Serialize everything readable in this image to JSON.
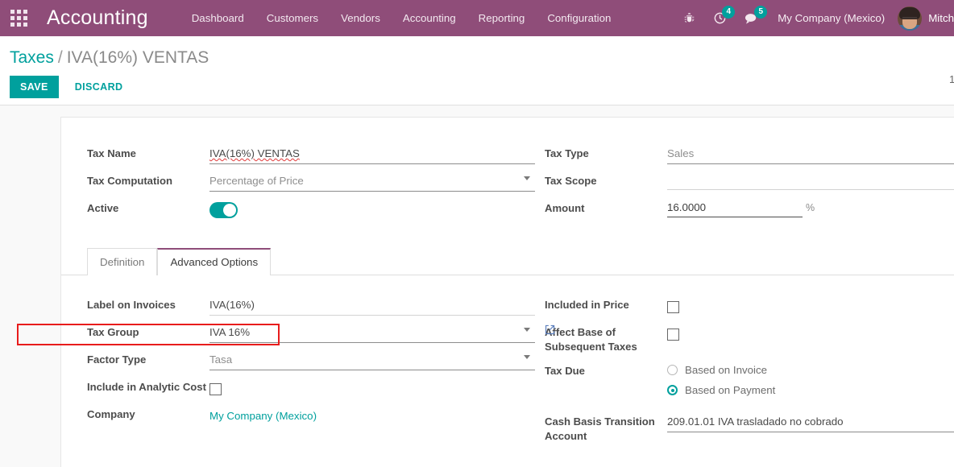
{
  "navbar": {
    "apps_icon": "apps-grid-icon",
    "brand": "Accounting",
    "menu": [
      {
        "label": "Dashboard"
      },
      {
        "label": "Customers"
      },
      {
        "label": "Vendors"
      },
      {
        "label": "Accounting"
      },
      {
        "label": "Reporting"
      },
      {
        "label": "Configuration"
      }
    ],
    "icons": [
      {
        "name": "bug-icon",
        "badge": null
      },
      {
        "name": "activity-clock-icon",
        "badge": "4"
      },
      {
        "name": "messages-icon",
        "badge": "5"
      }
    ],
    "company": "My Company (Mexico)",
    "user": "Mitch",
    "bg_color": "#8f4d79"
  },
  "control_panel": {
    "breadcrumb_root": "Taxes",
    "breadcrumb_sep": "/",
    "breadcrumb_current": "IVA(16%) VENTAS",
    "save_label": "SAVE",
    "discard_label": "DISCARD",
    "pager": "1",
    "accent_color": "#00a09d"
  },
  "form": {
    "left": {
      "tax_name_label": "Tax Name",
      "tax_name_value": "IVA(16%) VENTAS",
      "tax_computation_label": "Tax Computation",
      "tax_computation_value": "Percentage of Price",
      "active_label": "Active",
      "active_value": "on"
    },
    "right": {
      "tax_type_label": "Tax Type",
      "tax_type_value": "Sales",
      "tax_scope_label": "Tax Scope",
      "tax_scope_value": "",
      "amount_label": "Amount",
      "amount_value": "16.0000",
      "amount_suffix": "%"
    }
  },
  "notebook": {
    "tabs": [
      {
        "label": "Definition",
        "active": false
      },
      {
        "label": "Advanced Options",
        "active": true
      }
    ]
  },
  "advanced": {
    "left": {
      "label_on_invoices_label": "Label on Invoices",
      "label_on_invoices_value": "IVA(16%)",
      "tax_group_label": "Tax Group",
      "tax_group_value": "IVA 16%",
      "factor_type_label": "Factor Type",
      "factor_type_value": "Tasa",
      "include_analytic_label": "Include in Analytic Cost",
      "include_analytic_checked": false,
      "company_label": "Company",
      "company_value": "My Company (Mexico)"
    },
    "right": {
      "included_in_price_label": "Included in Price",
      "included_in_price_checked": false,
      "affect_base_label": "Affect Base of Subsequent Taxes",
      "affect_base_checked": false,
      "tax_due_label": "Tax Due",
      "tax_due_options": [
        {
          "label": "Based on Invoice",
          "selected": false
        },
        {
          "label": "Based on Payment",
          "selected": true
        }
      ],
      "cash_basis_label": "Cash Basis Transition Account",
      "cash_basis_value": "209.01.01 IVA trasladado no cobrado"
    }
  },
  "annotation": {
    "highlight_color": "#e81c1c",
    "highlight_target": "factor-type-field"
  }
}
